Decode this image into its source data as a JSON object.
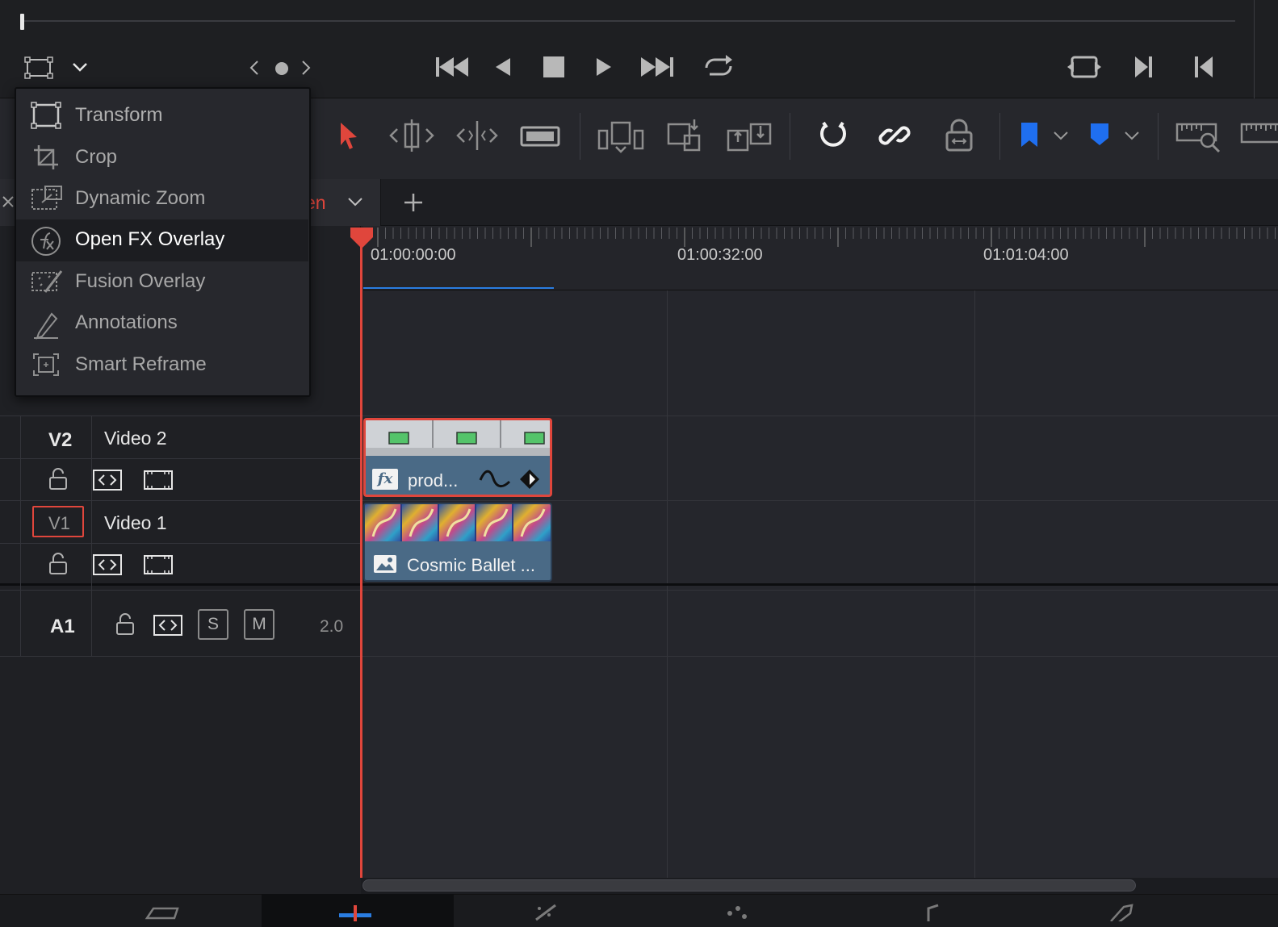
{
  "transport": {
    "viewer_mode_icon": "transform-rectangle-icon"
  },
  "timeline_tab": {
    "label": "en"
  },
  "ruler": {
    "timecodes": [
      "01:00:00:00",
      "01:00:32:00",
      "01:01:04:00"
    ]
  },
  "tracks": {
    "v2": {
      "id": "V2",
      "name": "Video 2"
    },
    "v1": {
      "id": "V1",
      "name": "Video 1"
    },
    "a1": {
      "id": "A1",
      "solo": "S",
      "mute": "M",
      "channels": "2.0"
    }
  },
  "clips": {
    "v2": {
      "label": "prod...",
      "badge": "fx"
    },
    "v1": {
      "label": "Cosmic Ballet ..."
    }
  },
  "menu": {
    "items": [
      {
        "label": "Transform",
        "icon": "transform-icon"
      },
      {
        "label": "Crop",
        "icon": "crop-icon"
      },
      {
        "label": "Dynamic Zoom",
        "icon": "dynamic-zoom-icon"
      },
      {
        "label": "Open FX Overlay",
        "icon": "fx-icon",
        "selected": true
      },
      {
        "label": "Fusion Overlay",
        "icon": "fusion-overlay-icon"
      },
      {
        "label": "Annotations",
        "icon": "annotations-pen-icon"
      },
      {
        "label": "Smart Reframe",
        "icon": "smart-reframe-icon"
      }
    ]
  },
  "colors": {
    "playhead": "#e0463c",
    "accent_blue": "#2a7de1",
    "clip_blue": "#4a6a86",
    "flag_blue": "#1f6ff0"
  }
}
